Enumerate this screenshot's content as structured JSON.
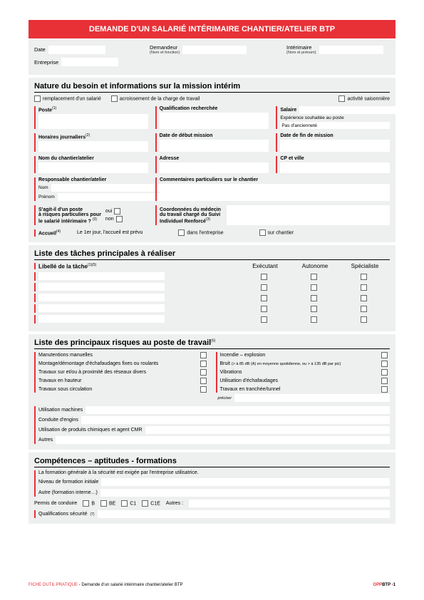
{
  "title": "DEMANDE D'UN SALARIÉ INTÉRIMAIRE CHANTIER/ATELIER BTP",
  "header": {
    "date": "Date",
    "entreprise": "Entreprise",
    "demandeur": "Demandeur",
    "demandeur_sub": "(Nom et fonction)",
    "interimaire": "Intérimaire",
    "interimaire_sub": "(Nom et prénom)"
  },
  "s1": {
    "title": "Nature du besoin et informations sur la mission intérim",
    "c1": "remplacement d'un salarié",
    "c2": "acroissement de la charge de travail",
    "c3": "activité saisonnière",
    "poste": "Poste",
    "poste_sup": "(1)",
    "qualif": "Qualification recherchée",
    "salaire": "Salaire",
    "exp": "Expérience souhaitée au poste",
    "anc": "Pas d'ancienneté",
    "horaires": "Horaires journaliers",
    "horaires_sup": "(2)",
    "debut": "Date de début mission",
    "fin": "Date de fin de mission",
    "chantier": "Nom du chantier/atelier",
    "adresse": "Adresse",
    "cp": "CP et ville",
    "resp": "Responsable chantier/atelier",
    "nom": "Nom",
    "prenom": "Prénom",
    "comm": "Commentaires particuliers sur le chantier",
    "q1a": "S'agit-il d'un poste",
    "q1b": "à risques particuliers pour",
    "q1c": "le salarié intérimaire ?",
    "q1sup": "(3)",
    "oui": "oui",
    "non": "non",
    "med1": "Coordonnées du médecin",
    "med2": "du travail chargé du Suivi",
    "med3": "Individuel Renforcé",
    "med_sup": "(3)",
    "accueil": "Accueil",
    "accueil_sup": "(4)",
    "accueil_txt": "Le 1er jour, l'accueil est prévu",
    "opt1": "dans l'entreprise",
    "opt2": "sur chantier"
  },
  "s2": {
    "title": "Liste des tâches principales à réaliser",
    "libelle": "Libellé de la tâche",
    "libelle_sup": "(1)(5)",
    "c1": "Exécutant",
    "c2": "Autonome",
    "c3": "Spécialiste"
  },
  "s3": {
    "title": "Liste des principaux risques au poste de travail",
    "title_sup": "(6)",
    "left": [
      "Manutentions manuelles",
      "Montage/démontage d'échafaudages fixes ou roulants",
      "Travaux sur et/ou à proximité des réseaux divers",
      "Travaux en hauteur",
      "Travaux sous circulation"
    ],
    "right": [
      "Incendie – explosion",
      "Bruit",
      "Vibrations",
      "Utilisation d'échafaudages",
      "Travaux en tranchée/tunnel"
    ],
    "bruit_sub": "(> à 85 dB (A) en moyenne quotidienne, ou > à 135 dB par pic)",
    "preciser": "préciser",
    "bottom": [
      "Utilisation machines",
      "Conduite d'engins",
      "Utilisation de produits chimiques et agent CMR",
      "Autres"
    ]
  },
  "s4": {
    "title": "Compétences – aptitudes - formations",
    "line1": "La formation générale à la sécurité est exigée par l'entreprise utilisatrice.",
    "line2": "Niveau de formation initiale",
    "line3": "Autre (formation interne…)",
    "permis": "Permis de conduire",
    "pB": "B",
    "pBE": "BE",
    "pC1": "C1",
    "pC1E": "C1E",
    "pAutres": "Autres :",
    "quals": "Qualifications sécurité",
    "quals_sup": "(7)"
  },
  "footer": {
    "left1": "FICHE OUTIL PRATIQUE",
    "left2": " - Demande d'un salarié intérimaire chantier/atelier BTP",
    "r1": "OPP",
    "r2": "BTP",
    "r3": " ›",
    "page": "1"
  }
}
